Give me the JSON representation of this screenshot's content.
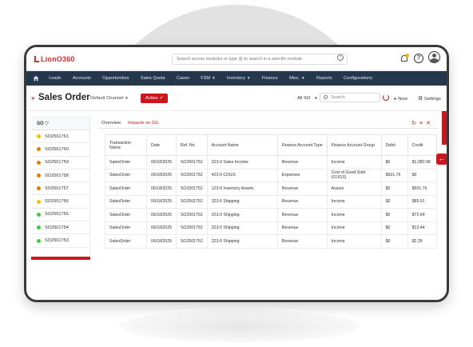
{
  "app": {
    "logo_text": "LionO360"
  },
  "topbar": {
    "search_placeholder": "Search across modules or type @ to search in a specific module"
  },
  "nav": {
    "items": [
      "Leads",
      "Accounts",
      "Opportunities",
      "Sales Quota",
      "Cases",
      "FSM",
      "Inventory",
      "Finance",
      "Misc.",
      "Reports",
      "Configurations"
    ]
  },
  "header": {
    "title": "Sales Order",
    "channel": "Default Channel",
    "status_button": "Active",
    "filter_label": "All SO",
    "search_placeholder": "Search",
    "new_label": "New",
    "settings_label": "Settings"
  },
  "list": {
    "header": "SO",
    "items": [
      {
        "id": "SO2501761",
        "color": "#f2c200"
      },
      {
        "id": "SO2501760",
        "color": "#f07a00"
      },
      {
        "id": "SO2501759",
        "color": "#f07a00"
      },
      {
        "id": "SO2501758",
        "color": "#f07a00"
      },
      {
        "id": "SO2501757",
        "color": "#f07a00"
      },
      {
        "id": "SO2501756",
        "color": "#f2c200"
      },
      {
        "id": "SO2501755",
        "color": "#3ccc3c"
      },
      {
        "id": "SO2501754",
        "color": "#3ccc3c"
      },
      {
        "id": "SO2501753",
        "color": "#3ccc3c"
      }
    ]
  },
  "tabs": [
    {
      "label": "Overview",
      "active": false
    },
    {
      "label": "Impacts on G/L",
      "active": true
    }
  ],
  "table": {
    "columns": [
      "Transaction Name",
      "Date",
      "Ref. No.",
      "Account Name",
      "Finance Account Type",
      "Finance Account Group",
      "Debit",
      "Credit"
    ],
    "rows": [
      [
        "SalesOrder",
        "06/18/2025",
        "SO2501752",
        "323-0 Sales Income",
        "Revenue",
        "Income",
        "$0",
        "$1,080.98"
      ],
      [
        "SalesOrder",
        "06/18/2025",
        "SO2501752",
        "423-0 COGS",
        "Expenses",
        "Cost of Good Sold (COGS)",
        "$501.76",
        "$0"
      ],
      [
        "SalesOrder",
        "06/18/2025",
        "SO2501752",
        "123-0 Inventory Assets",
        "Revenue",
        "Assets",
        "$0",
        "$501.76"
      ],
      [
        "SalesOrder",
        "06/18/2025",
        "SO2501752",
        "323-0 Shipping",
        "Revenue",
        "Income",
        "$0",
        "$85.91"
      ],
      [
        "SalesOrder",
        "06/18/2025",
        "SO2501752",
        "323-0 Shipping",
        "Revenue",
        "Income",
        "$0",
        "$72.64"
      ],
      [
        "SalesOrder",
        "06/18/2025",
        "SO2501752",
        "323-0 Shipping",
        "Revenue",
        "Income",
        "$0",
        "$13.44"
      ],
      [
        "SalesOrder",
        "06/18/2025",
        "SO2501752",
        "323-0 Shipping",
        "Revenue",
        "Income",
        "$0",
        "$2.28"
      ]
    ]
  },
  "colors": {
    "accent": "#c8181e",
    "nav_bg": "#25374a"
  }
}
